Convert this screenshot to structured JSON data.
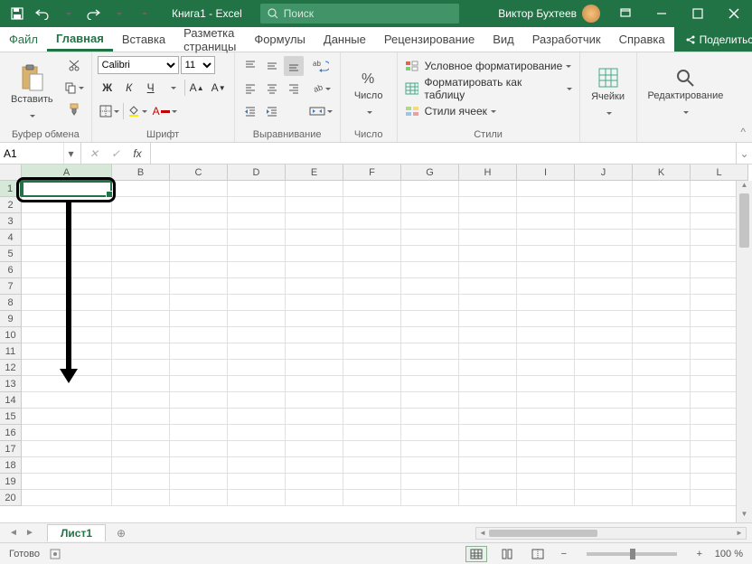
{
  "titlebar": {
    "doc_title": "Книга1 - Excel",
    "search_placeholder": "Поиск",
    "user_name": "Виктор Бухтеев"
  },
  "tabs": {
    "file": "Файл",
    "items": [
      "Главная",
      "Вставка",
      "Разметка страницы",
      "Формулы",
      "Данные",
      "Рецензирование",
      "Вид",
      "Разработчик",
      "Справка"
    ],
    "share": "Поделиться"
  },
  "ribbon": {
    "clipboard": {
      "paste": "Вставить",
      "label": "Буфер обмена"
    },
    "font": {
      "name": "Calibri",
      "size": "11",
      "label": "Шрифт"
    },
    "alignment": {
      "label": "Выравнивание"
    },
    "number": {
      "btn": "Число",
      "label": "Число"
    },
    "styles": {
      "conditional": "Условное форматирование",
      "table": "Форматировать как таблицу",
      "cell": "Стили ячеек",
      "label": "Стили"
    },
    "cells": {
      "btn": "Ячейки"
    },
    "editing": {
      "btn": "Редактирование"
    }
  },
  "formulabar": {
    "namebox": "A1",
    "formula": ""
  },
  "grid": {
    "columns": [
      "A",
      "B",
      "C",
      "D",
      "E",
      "F",
      "G",
      "H",
      "I",
      "J",
      "K",
      "L"
    ],
    "rows": [
      "1",
      "2",
      "3",
      "4",
      "5",
      "6",
      "7",
      "8",
      "9",
      "10",
      "11",
      "12",
      "13",
      "14",
      "15",
      "16",
      "17",
      "18",
      "19",
      "20"
    ]
  },
  "sheets": {
    "active": "Лист1"
  },
  "statusbar": {
    "ready": "Готово",
    "zoom": "100 %"
  }
}
